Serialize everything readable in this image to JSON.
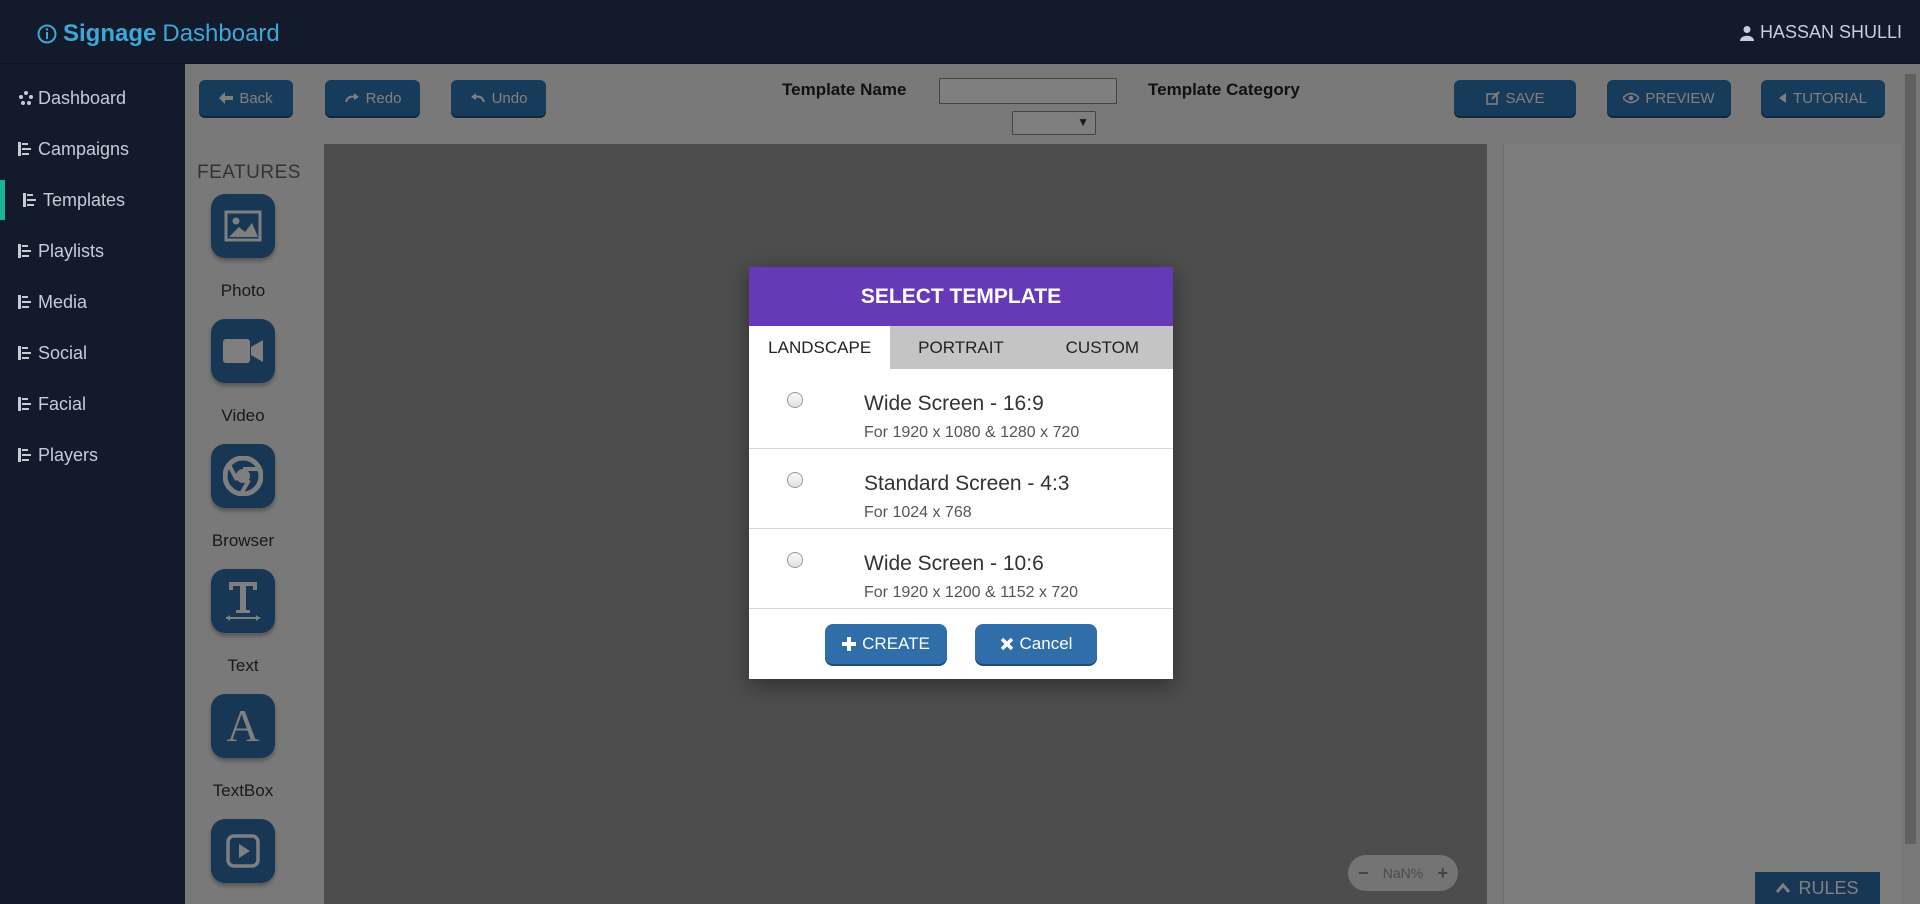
{
  "header": {
    "brand_strong": "Signage",
    "brand_light": "Dashboard",
    "user_name": "HASSAN SHULLI"
  },
  "sidebar": {
    "items": [
      {
        "label": "Dashboard"
      },
      {
        "label": "Campaigns"
      },
      {
        "label": "Templates",
        "active": true
      },
      {
        "label": "Playlists"
      },
      {
        "label": "Media"
      },
      {
        "label": "Social"
      },
      {
        "label": "Facial"
      },
      {
        "label": "Players"
      }
    ]
  },
  "toolbar": {
    "back": "Back",
    "redo": "Redo",
    "undo": "Undo",
    "template_name_label": "Template Name",
    "template_name_value": "",
    "template_category_label": "Template Category",
    "save": "SAVE",
    "preview": "PREVIEW",
    "tutorial": "TUTORIAL"
  },
  "features": {
    "title": "FEATURES",
    "items": [
      {
        "label": "Photo",
        "icon": "photo-icon"
      },
      {
        "label": "Video",
        "icon": "video-camera-icon"
      },
      {
        "label": "Browser",
        "icon": "chrome-icon"
      },
      {
        "label": "Text",
        "icon": "text-icon"
      },
      {
        "label": "TextBox",
        "icon": "textbox-icon"
      },
      {
        "label": "",
        "icon": "playlist-play-icon"
      }
    ]
  },
  "zoom": {
    "value": "NaN%"
  },
  "rules": {
    "label": "RULES"
  },
  "modal": {
    "title": "SELECT TEMPLATE",
    "tabs": [
      {
        "label": "LANDSCAPE",
        "active": true
      },
      {
        "label": "PORTRAIT"
      },
      {
        "label": "CUSTOM"
      }
    ],
    "options": [
      {
        "title": "Wide Screen - 16:9",
        "sub": "For 1920 x 1080 & 1280 x 720"
      },
      {
        "title": "Standard Screen - 4:3",
        "sub": "For 1024 x 768"
      },
      {
        "title": "Wide Screen - 10:6",
        "sub": "For 1920 x 1200 & 1152 x 720"
      }
    ],
    "create": "CREATE",
    "cancel": "Cancel"
  },
  "colors": {
    "accent": "#6639b7",
    "button": "#2f6ea8",
    "sidebar": "#121a2b",
    "active_indicator": "#1ab394"
  }
}
